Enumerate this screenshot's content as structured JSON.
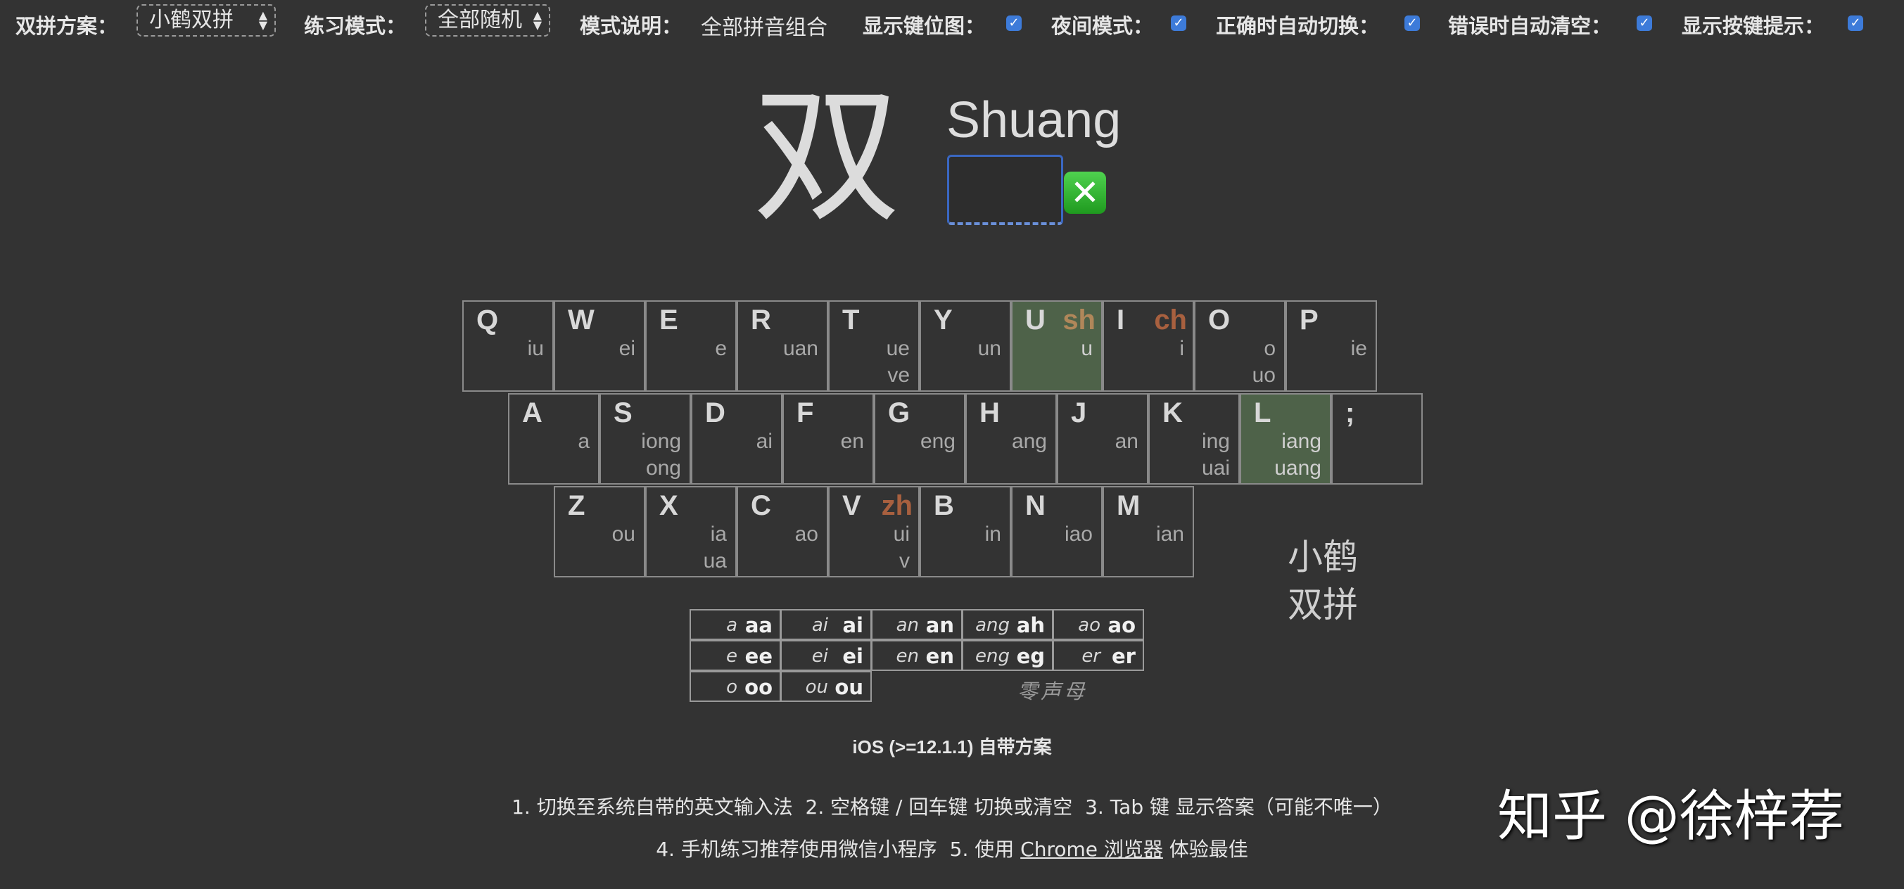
{
  "toolbar": {
    "scheme_label": "双拼方案：",
    "scheme_value": "小鹤双拼",
    "mode_label": "练习模式：",
    "mode_value": "全部随机",
    "desc_label": "模式说明：",
    "desc_value": "全部拼音组合",
    "show_keymap_label": "显示键位图：",
    "show_keymap": true,
    "night_label": "夜间模式：",
    "night": true,
    "auto_switch_label": "正确时自动切换：",
    "auto_switch": true,
    "auto_clear_label": "错误时自动清空：",
    "auto_clear": true,
    "show_hint_label": "显示按键提示：",
    "show_hint": true
  },
  "practice": {
    "hanzi": "双",
    "pinyin": "Shuang",
    "answer_value": "",
    "clear_icon": "✕"
  },
  "keyboard": {
    "accent_color": "#b0875a",
    "highlight_color": "#4e6249",
    "rows": [
      [
        {
          "letter": "Q",
          "v1": "iu",
          "v2": ""
        },
        {
          "letter": "W",
          "v1": "ei",
          "v2": ""
        },
        {
          "letter": "E",
          "v1": "e",
          "v2": ""
        },
        {
          "letter": "R",
          "v1": "uan",
          "v2": ""
        },
        {
          "letter": "T",
          "v1": "ue",
          "v2": "ve"
        },
        {
          "letter": "Y",
          "v1": "un",
          "v2": ""
        },
        {
          "letter": "U",
          "cons": "sh",
          "cons_color": "#b0875a",
          "v1": "u",
          "v2": "",
          "hl": true
        },
        {
          "letter": "I",
          "cons": "ch",
          "cons_color": "#a8603f",
          "v1": "i",
          "v2": ""
        },
        {
          "letter": "O",
          "v1": "o",
          "v2": "uo"
        },
        {
          "letter": "P",
          "v1": "ie",
          "v2": ""
        }
      ],
      [
        {
          "letter": "A",
          "v1": "a",
          "v2": ""
        },
        {
          "letter": "S",
          "v1": "iong",
          "v2": "ong"
        },
        {
          "letter": "D",
          "v1": "ai",
          "v2": ""
        },
        {
          "letter": "F",
          "v1": "en",
          "v2": ""
        },
        {
          "letter": "G",
          "v1": "eng",
          "v2": ""
        },
        {
          "letter": "H",
          "v1": "ang",
          "v2": ""
        },
        {
          "letter": "J",
          "v1": "an",
          "v2": ""
        },
        {
          "letter": "K",
          "v1": "ing",
          "v2": "uai"
        },
        {
          "letter": "L",
          "v1": "iang",
          "v2": "uang",
          "hl": true
        },
        {
          "letter": ";",
          "v1": "",
          "v2": ""
        }
      ],
      [
        {
          "letter": "Z",
          "v1": "ou",
          "v2": ""
        },
        {
          "letter": "X",
          "v1": "ia",
          "v2": "ua"
        },
        {
          "letter": "C",
          "v1": "ao",
          "v2": ""
        },
        {
          "letter": "V",
          "cons": "zh",
          "cons_color": "#a8603f",
          "v1": "ui",
          "v2": "v"
        },
        {
          "letter": "B",
          "v1": "in",
          "v2": ""
        },
        {
          "letter": "N",
          "v1": "iao",
          "v2": ""
        },
        {
          "letter": "M",
          "v1": "ian",
          "v2": ""
        }
      ]
    ],
    "brand_line1": "小鹤",
    "brand_line2": "双拼"
  },
  "zero_initial": {
    "rows": [
      [
        {
          "f": "a",
          "k": "aa"
        },
        {
          "f": "ai",
          "k": "ai"
        },
        {
          "f": "an",
          "k": "an"
        },
        {
          "f": "ang",
          "k": "ah"
        },
        {
          "f": "ao",
          "k": "ao"
        }
      ],
      [
        {
          "f": "e",
          "k": "ee"
        },
        {
          "f": "ei",
          "k": "ei"
        },
        {
          "f": "en",
          "k": "en"
        },
        {
          "f": "eng",
          "k": "eg"
        },
        {
          "f": "er",
          "k": "er"
        }
      ],
      [
        {
          "f": "o",
          "k": "oo"
        },
        {
          "f": "ou",
          "k": "ou"
        }
      ]
    ],
    "label": "零声母"
  },
  "footer": {
    "scheme_note": "iOS (>=12.1.1) 自带方案",
    "tip1": "1. 切换至系统自带的英文输入法",
    "tip2": "2. 空格键 / 回车键 切换或清空",
    "tip3": "3. Tab 键 显示答案（可能不唯一）",
    "tip4": "4. 手机练习推荐使用微信小程序",
    "tip5_prefix": "5. 使用",
    "tip5_link": "Chrome 浏览器",
    "tip5_suffix": "体验最佳"
  },
  "watermark": "知乎 @徐梓荐"
}
